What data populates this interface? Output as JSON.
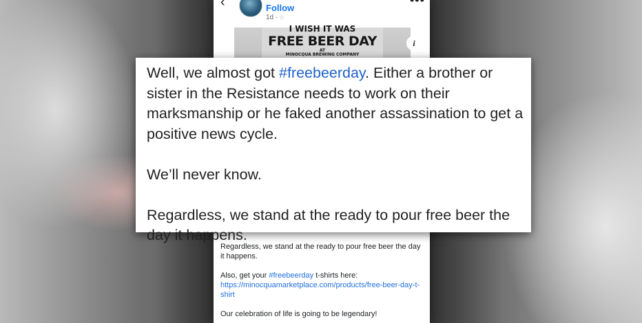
{
  "post": {
    "follow_label": "Follow",
    "time": "1d ·",
    "shirt": {
      "line1": "I WISH IT WAS",
      "line2": "FREE BEER DAY",
      "line3": "AT",
      "line4": "MINOCQUA BREWING COMPANY"
    },
    "caption_lower": {
      "p1": "Regardless, we stand at the ready to pour free beer the day it happens.",
      "p2_prefix": "Also, get your ",
      "p2_hashtag": "#freebeerday",
      "p2_middle": " t-shirts here: ",
      "p2_link": "https://minocquamarketplace.com/products/free-beer-day-t-shirt",
      "p3": "Our celebration of life is going to be legendary!"
    }
  },
  "zoomed_caption": {
    "p1_before": "Well, we almost got ",
    "p1_hashtag": "#freebeerday",
    "p1_after": ".  Either a brother or sister in the Resistance needs to work on their marksmanship or he faked another assassination to get a positive news cycle.",
    "p2": "We’ll never know.",
    "p3": "Regardless, we stand at the ready to pour free beer the day it happens."
  },
  "colors": {
    "link_blue": "#1877f2",
    "hashtag_blue": "#1f62c9",
    "text": "#222222",
    "card_bg": "#ffffff"
  },
  "icons": [
    "back-arrow-icon",
    "more-options-icon",
    "globe-icon",
    "info-icon"
  ]
}
